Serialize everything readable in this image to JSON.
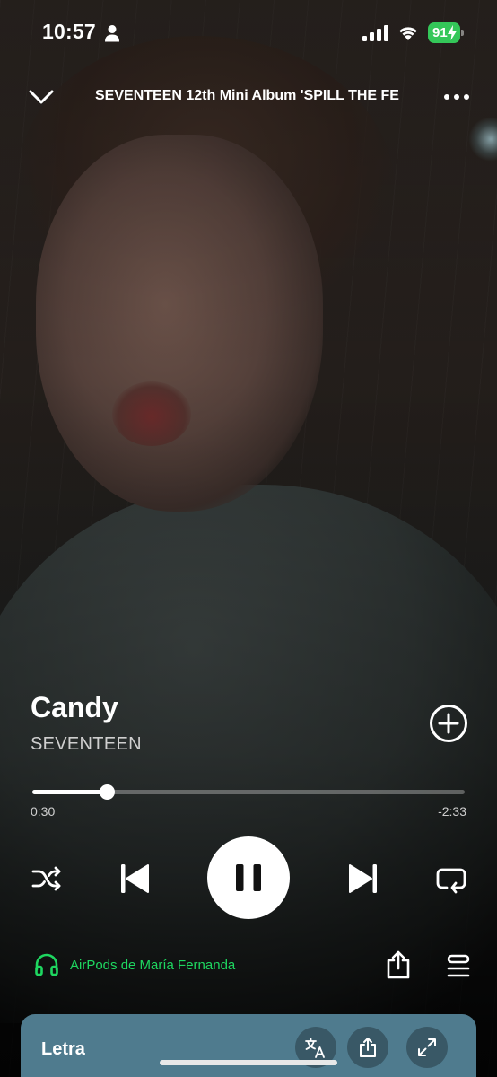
{
  "status_bar": {
    "time": "10:57",
    "battery": "91",
    "battery_color": "#34c759"
  },
  "header": {
    "title": "SEVENTEEN 12th Mini Album 'SPILL THE FE"
  },
  "track": {
    "title": "Candy",
    "artist": "SEVENTEEN"
  },
  "progress": {
    "elapsed": "0:30",
    "remaining": "-2:33",
    "fraction": 0.172
  },
  "controls": {
    "icons": [
      "shuffle-icon",
      "previous-icon",
      "pause-icon",
      "next-icon",
      "repeat-icon"
    ]
  },
  "device": {
    "label": "AirPods de María Fernanda",
    "accent_color": "#1ed760"
  },
  "lyrics": {
    "title": "Letra",
    "card_color": "#4f7b8e"
  }
}
